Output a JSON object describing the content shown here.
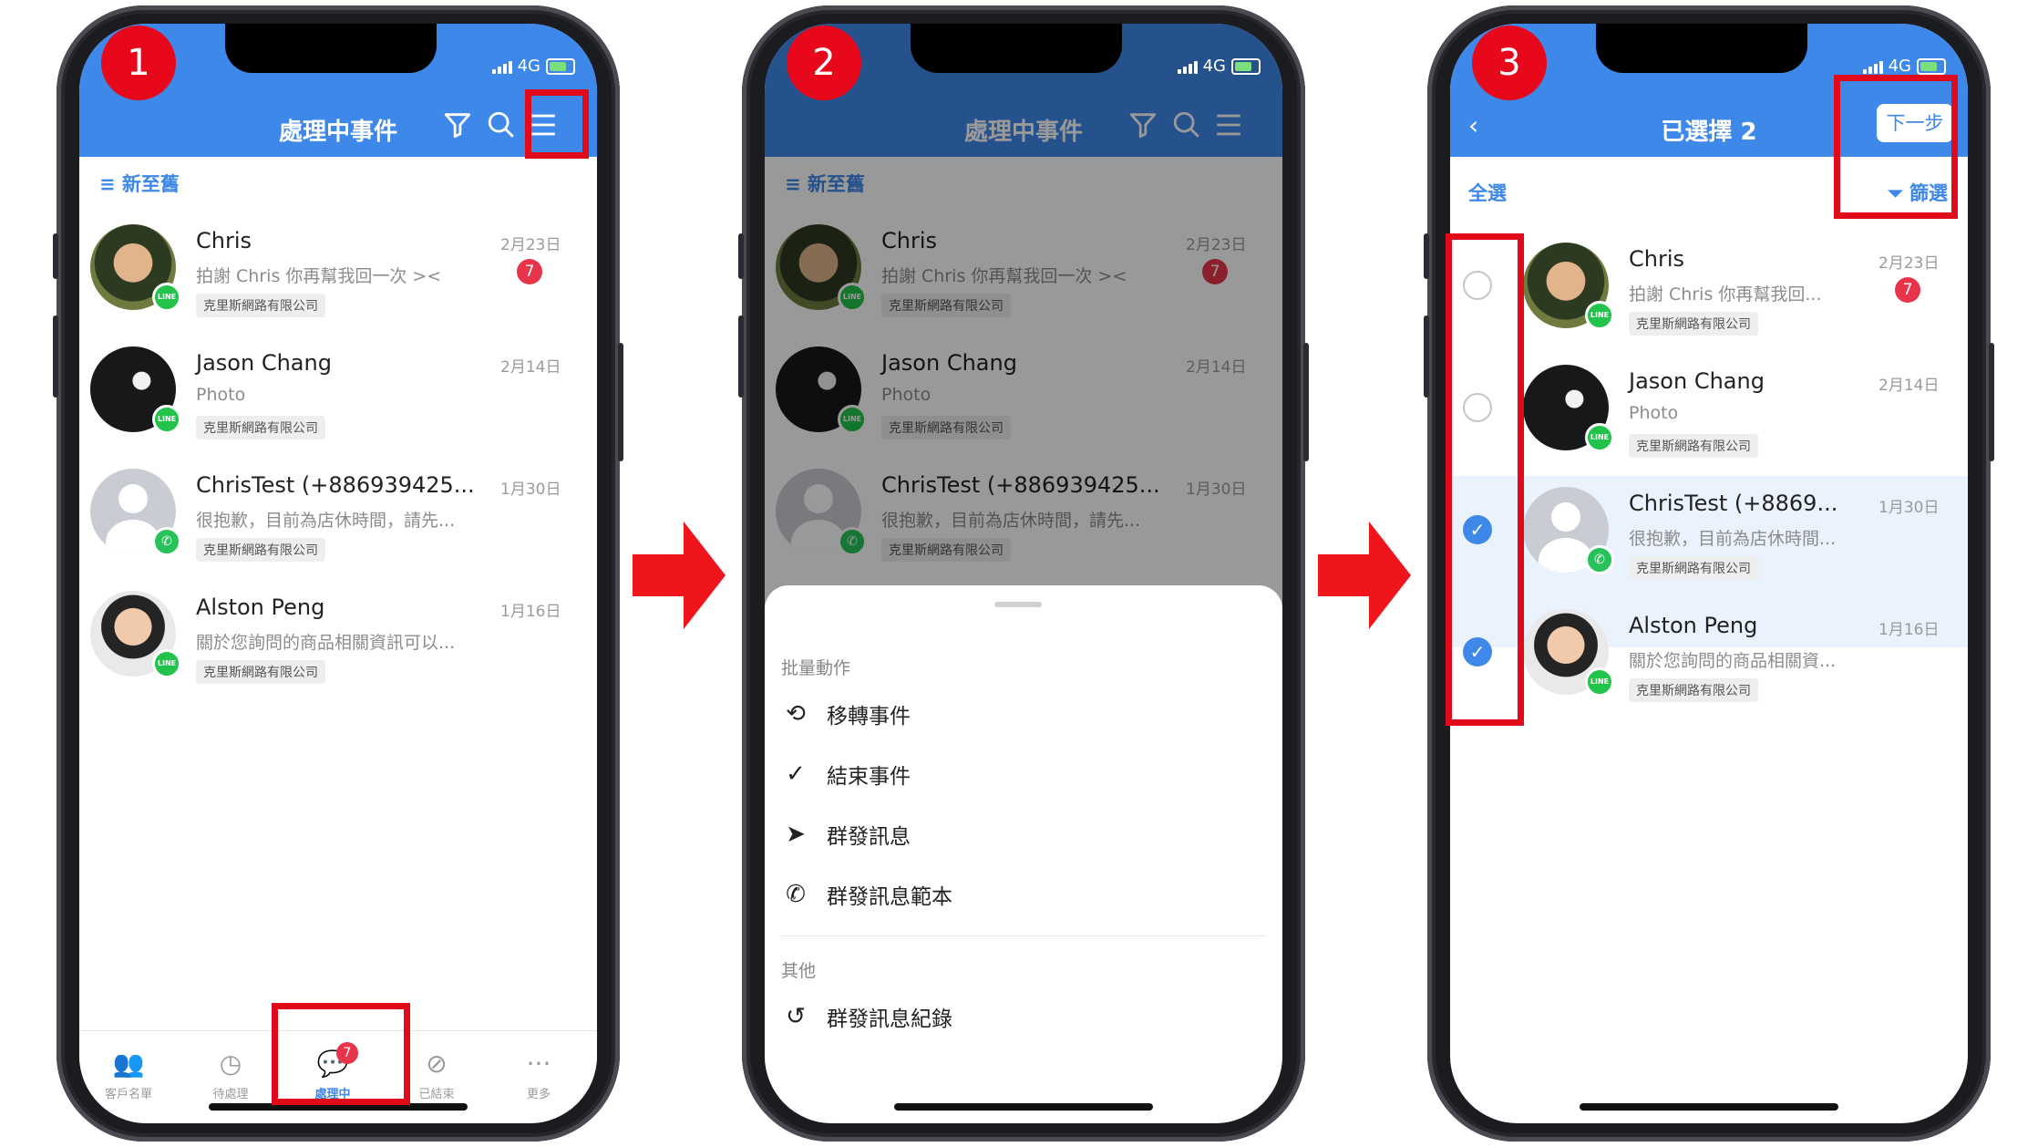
{
  "status": {
    "network": "4G"
  },
  "step_numbers": [
    "1",
    "2",
    "3"
  ],
  "colors": {
    "header": "#3e88e9",
    "highlight": "#e00a1a",
    "badge": "#e8344a",
    "arrow": "#f0141c"
  },
  "conversations": [
    {
      "name": "Chris",
      "preview": "拍謝 Chris 你再幫我回一次 ><",
      "preview_short": "拍謝 Chris 你再幫我回...",
      "date": "2月23日",
      "unread": "7",
      "tag": "克里斯網路有限公司",
      "channel": "LINE",
      "name_short": "Chris"
    },
    {
      "name": "Jason Chang",
      "preview": "Photo",
      "preview_short": "Photo",
      "date": "2月14日",
      "unread": "",
      "tag": "克里斯網路有限公司",
      "channel": "LINE",
      "name_short": "Jason Chang"
    },
    {
      "name": "ChrisTest (+886939425...",
      "preview": "很抱歉，目前為店休時間，請先...",
      "preview_short": "很抱歉，目前為店休時間...",
      "date": "1月30日",
      "unread": "",
      "tag": "克里斯網路有限公司",
      "channel": "WhatsApp",
      "name_short": "ChrisTest (+8869..."
    },
    {
      "name": "Alston Peng",
      "preview": "關於您詢問的商品相關資訊可以...",
      "preview_short": "關於您詢問的商品相關資...",
      "date": "1月16日",
      "unread": "",
      "tag": "克里斯網路有限公司",
      "channel": "LINE",
      "name_short": "Alston Peng"
    }
  ],
  "screen1": {
    "title": "處理中事件",
    "sort_label": "新至舊",
    "tabs": [
      {
        "label": "客戶名單",
        "icon": "users-icon"
      },
      {
        "label": "待處理",
        "icon": "pending-icon"
      },
      {
        "label": "處理中",
        "icon": "chat-icon",
        "badge": "7",
        "active": true
      },
      {
        "label": "已結束",
        "icon": "check-circle-icon"
      },
      {
        "label": "更多",
        "icon": "more-icon"
      }
    ]
  },
  "screen2": {
    "title": "處理中事件",
    "sort_label": "新至舊",
    "section_batch": "批量動作",
    "actions": [
      "移轉事件",
      "結束事件",
      "群發訊息",
      "群發訊息範本"
    ],
    "section_other": "其他",
    "other_actions": [
      "群發訊息紀錄"
    ]
  },
  "screen3": {
    "title": "已選擇 2",
    "next_label": "下一步",
    "select_all": "全選",
    "filter_label": "篩選",
    "selected": [
      false,
      false,
      true,
      true
    ]
  }
}
